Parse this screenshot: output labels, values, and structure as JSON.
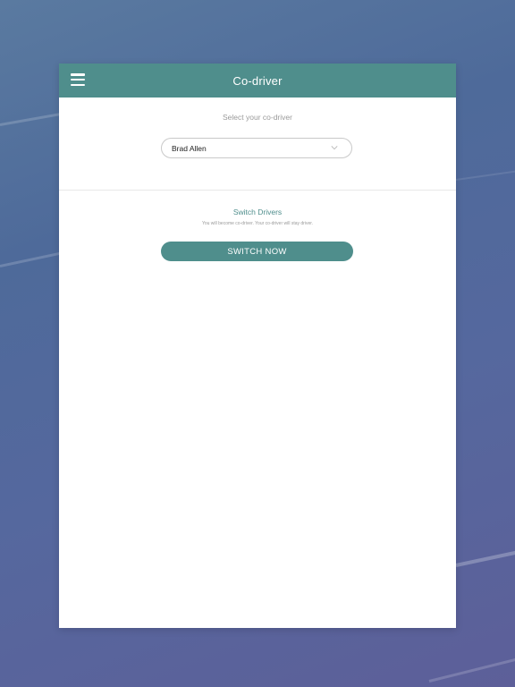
{
  "header": {
    "title": "Co-driver"
  },
  "codriver_select": {
    "label": "Select your co-driver",
    "selected": "Brad Allen"
  },
  "switch": {
    "title": "Switch Drivers",
    "subtitle": "You will become co-driver. Your co-driver will stay driver.",
    "button_label": "SWITCH NOW"
  },
  "colors": {
    "accent": "#4f8e8c",
    "panel": "#ffffff"
  },
  "icons": {
    "menu": "hamburger-menu-icon",
    "dropdown": "chevron-down-icon"
  }
}
